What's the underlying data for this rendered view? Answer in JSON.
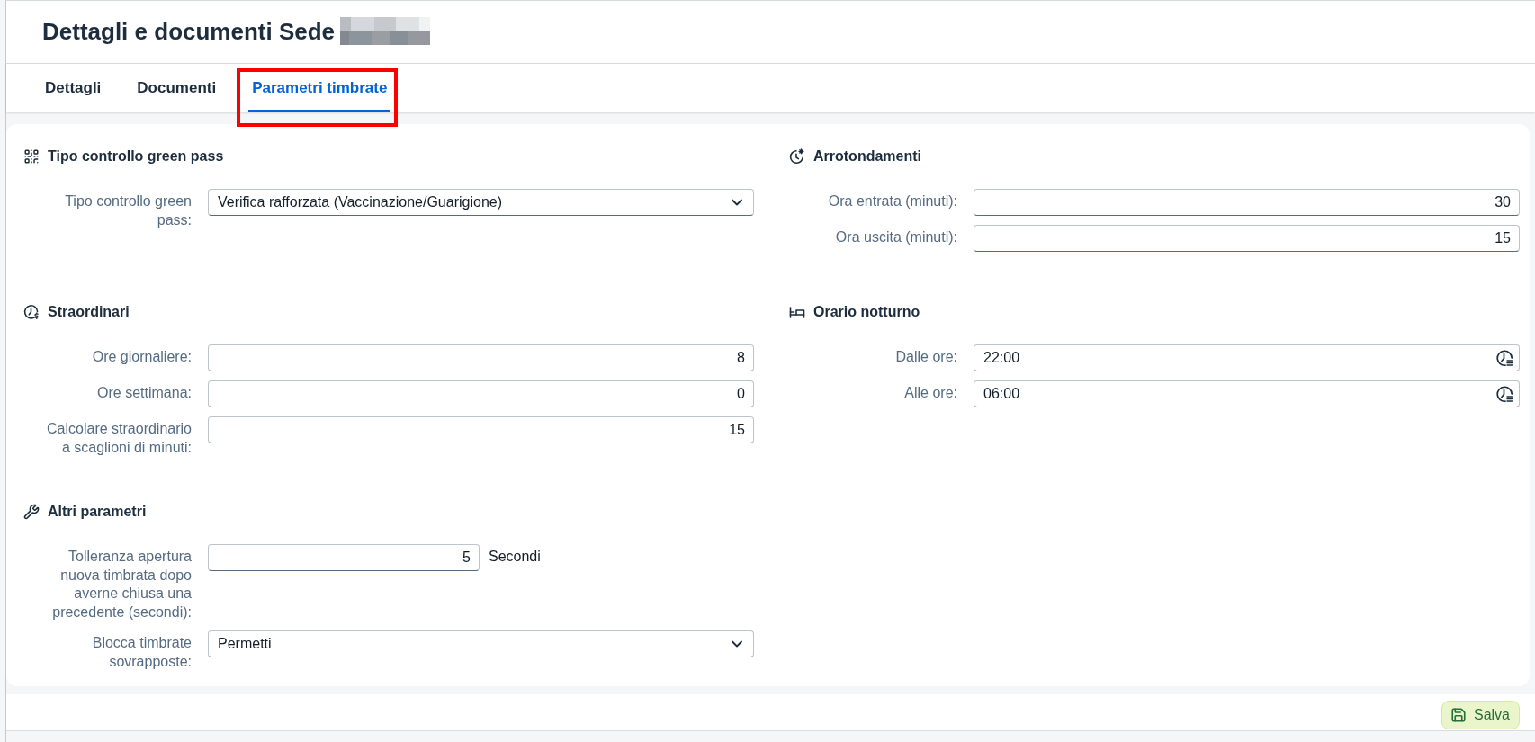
{
  "header": {
    "title": "Dettagli e documenti Sede"
  },
  "tabs": [
    {
      "label": "Dettagli",
      "selected": false,
      "highlighted": false
    },
    {
      "label": "Documenti",
      "selected": false,
      "highlighted": false
    },
    {
      "label": "Parametri timbrate",
      "selected": true,
      "highlighted": true
    }
  ],
  "sections": [
    {
      "title": "Tipo controllo green pass",
      "fields": [
        {
          "kind": "select",
          "label": "Tipo controllo green pass:",
          "value": "Verifica rafforzata (Vaccinazione/Guarigione)"
        }
      ]
    },
    {
      "title": "Arrotondamenti",
      "fields": [
        {
          "kind": "number",
          "label": "Ora entrata (minuti):",
          "value": "30"
        },
        {
          "kind": "number",
          "label": "Ora uscita (minuti):",
          "value": "15"
        }
      ]
    },
    {
      "title": "Straordinari",
      "fields": [
        {
          "kind": "number",
          "label": "Ore giornaliere:",
          "value": "8"
        },
        {
          "kind": "number",
          "label": "Ore settimana:",
          "value": "0"
        },
        {
          "kind": "number",
          "label": "Calcolare straordinario a scaglioni di minuti:",
          "value": "15"
        }
      ]
    },
    {
      "title": "Orario notturno",
      "fields": [
        {
          "kind": "time",
          "label": "Dalle ore:",
          "value": "22:00"
        },
        {
          "kind": "time",
          "label": "Alle ore:",
          "value": "06:00"
        }
      ]
    },
    {
      "title": "Altri parametri",
      "fields": [
        {
          "kind": "number",
          "label": "Tolleranza apertura nuova timbrata dopo averne chiusa una precedente (secondi):",
          "value": "5",
          "unit": "Secondi"
        },
        {
          "kind": "select",
          "label": "Blocca timbrate sovrapposte:",
          "value": "Permetti"
        }
      ]
    }
  ],
  "footer": {
    "save_button": "Salva"
  }
}
